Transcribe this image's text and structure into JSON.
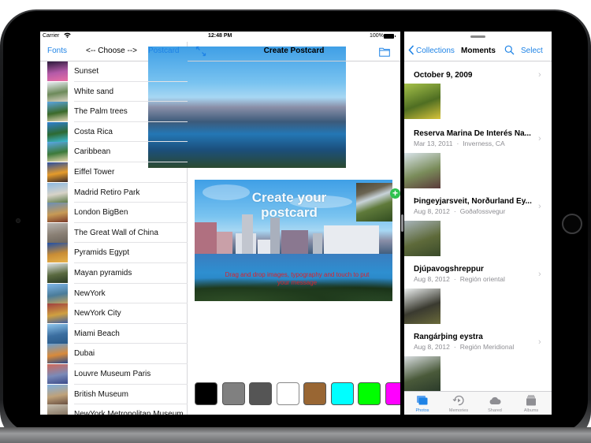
{
  "status_bar": {
    "carrier": "Carrier",
    "time": "12:48 PM",
    "battery": "100%"
  },
  "master": {
    "nav": {
      "left_label": "Fonts",
      "title": "<-- Choose -->",
      "right_label": "Postcard"
    },
    "items": [
      {
        "label": "Sunset",
        "thumb_colors": [
          "#2a1a3a",
          "#b45aa8",
          "#e96fa4"
        ]
      },
      {
        "label": "White sand",
        "thumb_colors": [
          "#e8ecf2",
          "#6d8a5a",
          "#d9d2c4"
        ]
      },
      {
        "label": "The Palm trees",
        "thumb_colors": [
          "#5aa4e0",
          "#3b6a2a",
          "#e2d6b8"
        ]
      },
      {
        "label": "Costa Rica",
        "thumb_colors": [
          "#2e7fd0",
          "#2d6a32",
          "#3dbbd8"
        ]
      },
      {
        "label": "Caribbean",
        "thumb_colors": [
          "#59a7e8",
          "#3d7a3a",
          "#e9d8b0"
        ]
      },
      {
        "label": "Eiffel Tower",
        "thumb_colors": [
          "#2a4fa0",
          "#e59b2a",
          "#3a2a2a"
        ]
      },
      {
        "label": "Madrid Retiro Park",
        "thumb_colors": [
          "#8bb9e3",
          "#d7d3c8",
          "#5d7b4a"
        ]
      },
      {
        "label": "London BigBen",
        "thumb_colors": [
          "#6a8fb8",
          "#c79a55",
          "#7a3a2a"
        ]
      },
      {
        "label": "The Great Wall of China",
        "thumb_colors": [
          "#b8b4b0",
          "#8a8075",
          "#6d665d"
        ]
      },
      {
        "label": "Pyramids Egypt",
        "thumb_colors": [
          "#1f4fa8",
          "#c98d35",
          "#e6b24a"
        ]
      },
      {
        "label": "Mayan pyramids",
        "thumb_colors": [
          "#dfe4e6",
          "#5a6a40",
          "#2a3a24"
        ]
      },
      {
        "label": "NewYork",
        "thumb_colors": [
          "#7fb6e8",
          "#4a7c9a",
          "#c1a25e"
        ]
      },
      {
        "label": "NewYork City",
        "thumb_colors": [
          "#a04040",
          "#d0a040",
          "#4060a0"
        ]
      },
      {
        "label": "Miami Beach",
        "thumb_colors": [
          "#8fc6ec",
          "#3b6ea0",
          "#2a5a88"
        ]
      },
      {
        "label": "Dubai",
        "thumb_colors": [
          "#6a9fd0",
          "#d98a3a",
          "#2a4a8a"
        ]
      },
      {
        "label": "Louvre Museum Paris",
        "thumb_colors": [
          "#d06a5a",
          "#7a8ab8",
          "#3a4a8a"
        ]
      },
      {
        "label": "British Museum",
        "thumb_colors": [
          "#7fb0e0",
          "#bfa27a",
          "#6a5040"
        ]
      },
      {
        "label": "NewYork Metropolitan Museum",
        "thumb_colors": [
          "#c8c0b0",
          "#8a7a68",
          "#5a5048"
        ]
      }
    ]
  },
  "detail": {
    "nav": {
      "title": "Create Postcard",
      "left_icon": "expand-arrows-icon",
      "right_icon": "folder-icon"
    },
    "postcard": {
      "title": "Create your postcard",
      "message": "Drag and drop images, typography and touch to put your message",
      "add_badge": "+"
    },
    "swatches": [
      {
        "name": "black",
        "color": "#000000"
      },
      {
        "name": "gray",
        "color": "#808080"
      },
      {
        "name": "dark-gray",
        "color": "#555555"
      },
      {
        "name": "white",
        "color": "#ffffff"
      },
      {
        "name": "brown",
        "color": "#996633"
      },
      {
        "name": "cyan",
        "color": "#00ffff"
      },
      {
        "name": "green",
        "color": "#00ff00"
      },
      {
        "name": "magenta",
        "color": "#ff00ff"
      }
    ]
  },
  "photos": {
    "nav": {
      "back_label": "Collections",
      "title": "Moments",
      "select_label": "Select"
    },
    "moments": [
      {
        "title": "October 9, 2009",
        "date": "",
        "place": "",
        "thumb_colors": [
          "#a6c24a",
          "#4f6e22",
          "#d8c33a"
        ]
      },
      {
        "title": "Reserva Marina De Interés Na...",
        "date": "Mar 13, 2011",
        "place": "Inverness, CA",
        "thumb_colors": [
          "#d9e4ea",
          "#7a8c5a",
          "#5a3a3a"
        ]
      },
      {
        "title": "Þingeyjarsveit, Norðurland Ey...",
        "date": "Aug 8, 2012",
        "place": "Goðafossvegur",
        "thumb_colors": [
          "#a8b4ba",
          "#5e6a3a",
          "#3a4a2a"
        ]
      },
      {
        "title": "Djúpavogshreppur",
        "date": "Aug 8, 2012",
        "place": "Región oriental",
        "thumb_colors": [
          "#ecefef",
          "#3a3a30",
          "#6a6a3a"
        ]
      },
      {
        "title": "Rangárþing eystra",
        "date": "Aug 8, 2012",
        "place": "Región Meridional",
        "thumb_colors": [
          "#d8dde0",
          "#4a5a3a",
          "#2a3a2a"
        ]
      }
    ],
    "separator": "·",
    "tabs": [
      {
        "label": "Photos",
        "icon": "photos-icon",
        "active": true
      },
      {
        "label": "Memories",
        "icon": "memories-icon",
        "active": false
      },
      {
        "label": "Shared",
        "icon": "cloud-icon",
        "active": false
      },
      {
        "label": "Albums",
        "icon": "albums-icon",
        "active": false
      }
    ]
  },
  "colors": {
    "accent": "#1e83e6",
    "add_badge": "#2ec24f",
    "message_text": "#d9232c"
  }
}
